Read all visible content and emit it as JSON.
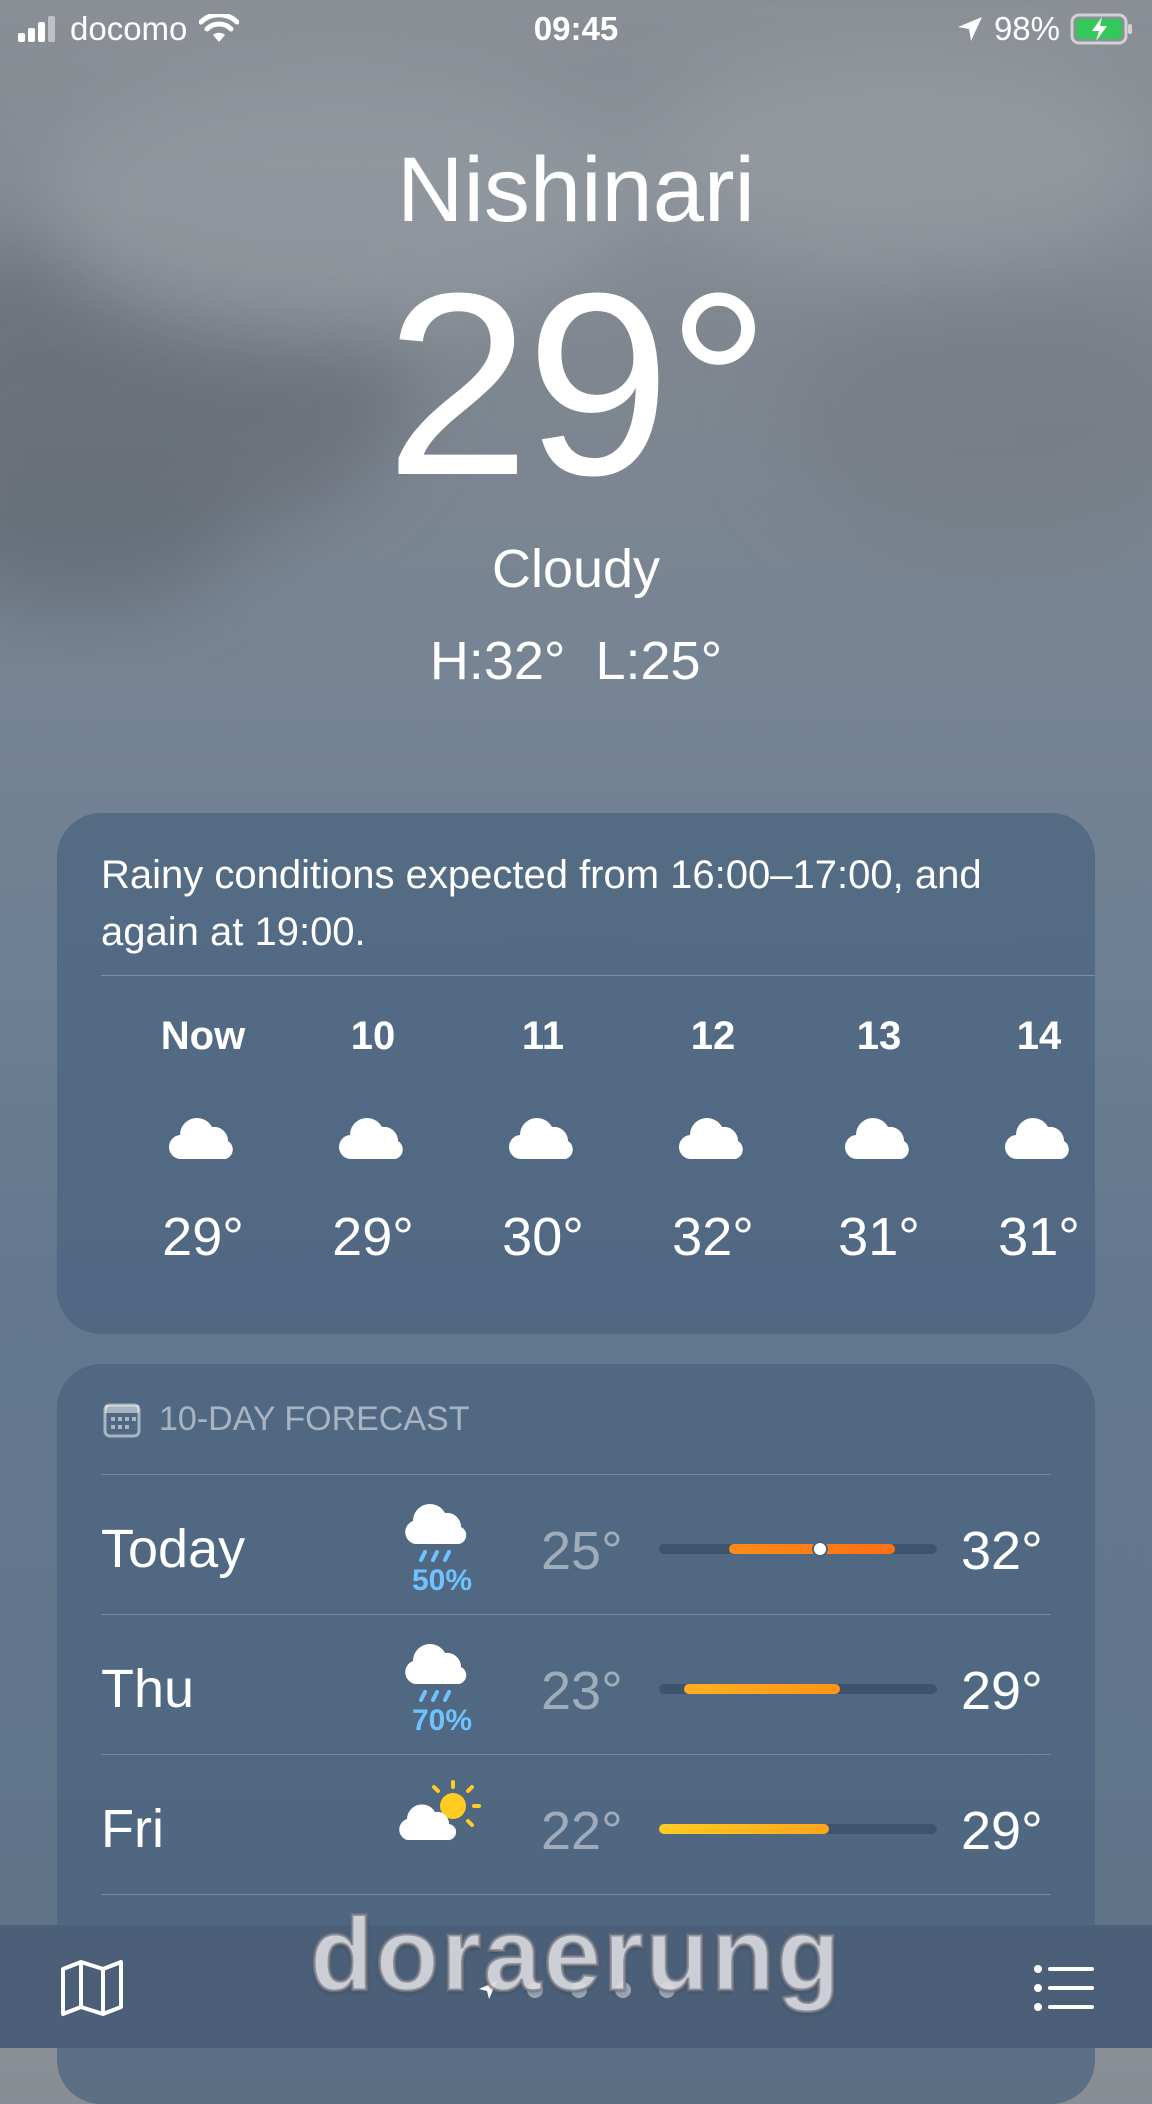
{
  "status_bar": {
    "carrier": "docomo",
    "time": "09:45",
    "battery": "98%",
    "icons": [
      "signal-icon",
      "wifi-icon",
      "location-arrow-icon",
      "battery-charging-icon"
    ]
  },
  "current": {
    "city": "Nishinari",
    "temperature": "29°",
    "condition": "Cloudy",
    "high_low": "H:32°  L:25°"
  },
  "hourly": {
    "summary": "Rainy conditions expected from 16:00–17:00, and again at 19:00.",
    "hours": [
      {
        "label": "Now",
        "icon": "cloud-icon",
        "temp": "29°"
      },
      {
        "label": "10",
        "icon": "cloud-icon",
        "temp": "29°"
      },
      {
        "label": "11",
        "icon": "cloud-icon",
        "temp": "30°"
      },
      {
        "label": "12",
        "icon": "cloud-icon",
        "temp": "32°"
      },
      {
        "label": "13",
        "icon": "cloud-icon",
        "temp": "31°"
      },
      {
        "label": "14",
        "icon": "cloud-icon",
        "temp": "31°"
      }
    ]
  },
  "daily": {
    "header": "10-DAY FORECAST",
    "days": [
      {
        "name": "Today",
        "icon": "cloud-rain-icon",
        "precip": "50%",
        "low": "25°",
        "high": "32°",
        "bar_start": 0.25,
        "bar_end": 0.85,
        "current_marker": 0.58,
        "bar_colors": [
          "#ff8c1a",
          "#ff6f14"
        ]
      },
      {
        "name": "Thu",
        "icon": "cloud-rain-icon",
        "precip": "70%",
        "low": "23°",
        "high": "29°",
        "bar_start": 0.09,
        "bar_end": 0.65,
        "bar_colors": [
          "#ffb020",
          "#ff9418"
        ]
      },
      {
        "name": "Fri",
        "icon": "sun-cloud-icon",
        "precip": "",
        "low": "22°",
        "high": "29°",
        "bar_start": 0.0,
        "bar_end": 0.61,
        "bar_colors": [
          "#ffcc22",
          "#ffa41a"
        ]
      }
    ]
  },
  "tab_bar": {
    "map_icon": "map-icon",
    "list_icon": "list-icon",
    "page_dots": 5
  },
  "watermark": "doraerung"
}
